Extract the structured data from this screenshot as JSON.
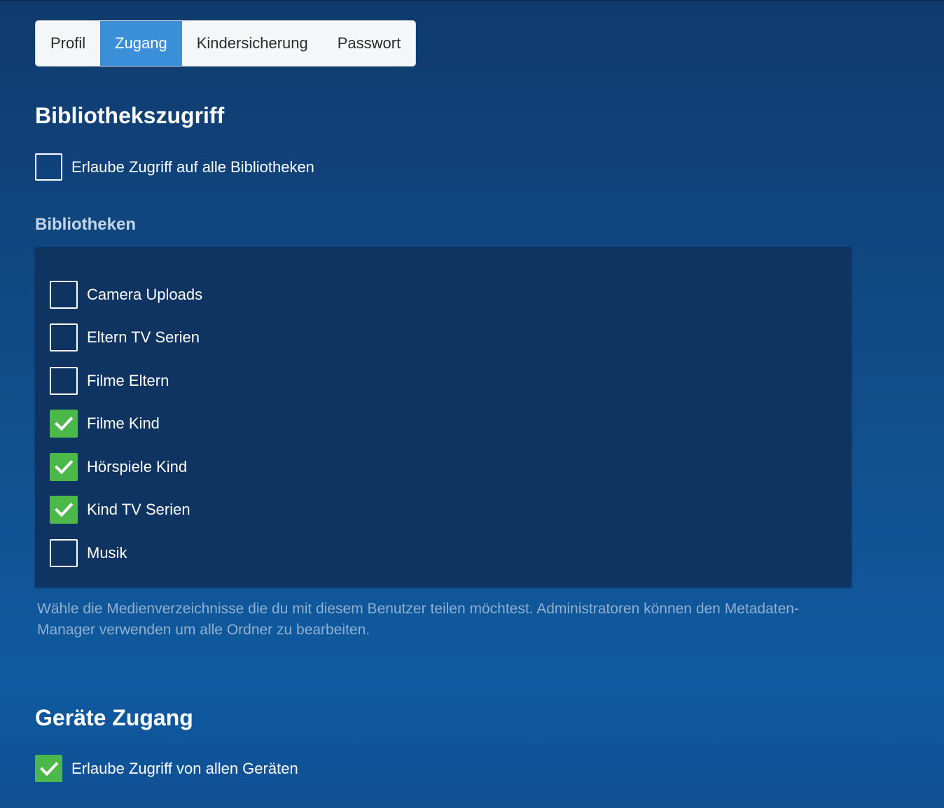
{
  "tabs": [
    {
      "label": "Profil",
      "active": false
    },
    {
      "label": "Zugang",
      "active": true
    },
    {
      "label": "Kindersicherung",
      "active": false
    },
    {
      "label": "Passwort",
      "active": false
    }
  ],
  "library_access": {
    "title": "Bibliothekszugriff",
    "allow_all_label": "Erlaube Zugriff auf alle Bibliotheken",
    "allow_all_checked": false,
    "libraries_title": "Bibliotheken",
    "libraries": [
      {
        "label": "Camera Uploads",
        "checked": false
      },
      {
        "label": "Eltern TV Serien",
        "checked": false
      },
      {
        "label": "Filme Eltern",
        "checked": false
      },
      {
        "label": "Filme Kind",
        "checked": true
      },
      {
        "label": "Hörspiele Kind",
        "checked": true
      },
      {
        "label": "Kind TV Serien",
        "checked": true
      },
      {
        "label": "Musik",
        "checked": false
      }
    ],
    "help_text": "Wähle die Medienverzeichnisse die du mit diesem Benutzer teilen möchtest. Administratoren können den Metadaten-Manager verwenden um alle Ordner zu bearbeiten."
  },
  "device_access": {
    "title": "Geräte Zugang",
    "allow_all_label": "Erlaube Zugriff von allen Geräten",
    "allow_all_checked": true
  },
  "colors": {
    "accent_tab": "#3b8fd9",
    "checkbox_checked": "#4cb84a",
    "panel_bg": "#0f3461"
  },
  "icons": {
    "checkbox_tick": "check-icon"
  }
}
